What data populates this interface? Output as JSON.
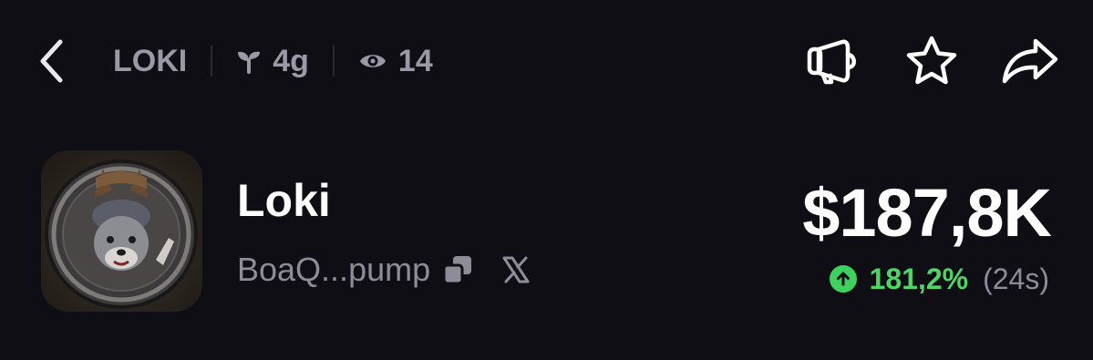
{
  "header": {
    "ticker": "LOKI",
    "age": "4g",
    "viewers": "14",
    "icons": {
      "back": "chevron-left-icon",
      "age": "sprout-icon",
      "viewers": "eye-icon",
      "announce": "megaphone-icon",
      "favorite": "star-icon",
      "share": "share-arrow-icon"
    }
  },
  "token": {
    "name": "Loki",
    "address": "BoaQ...pump",
    "image_alt": "loki-coin-icon",
    "icons": {
      "copy": "copy-icon",
      "social": "x-logo-icon"
    }
  },
  "market": {
    "price": "$187,8K",
    "change": "181,2%",
    "period": "(24s)",
    "change_icon": "arrow-up-circle-icon"
  },
  "colors": {
    "background": "#0f0e15",
    "muted_text": "#9a99a5",
    "positive": "#4fd466",
    "primary_text": "#ffffff"
  }
}
